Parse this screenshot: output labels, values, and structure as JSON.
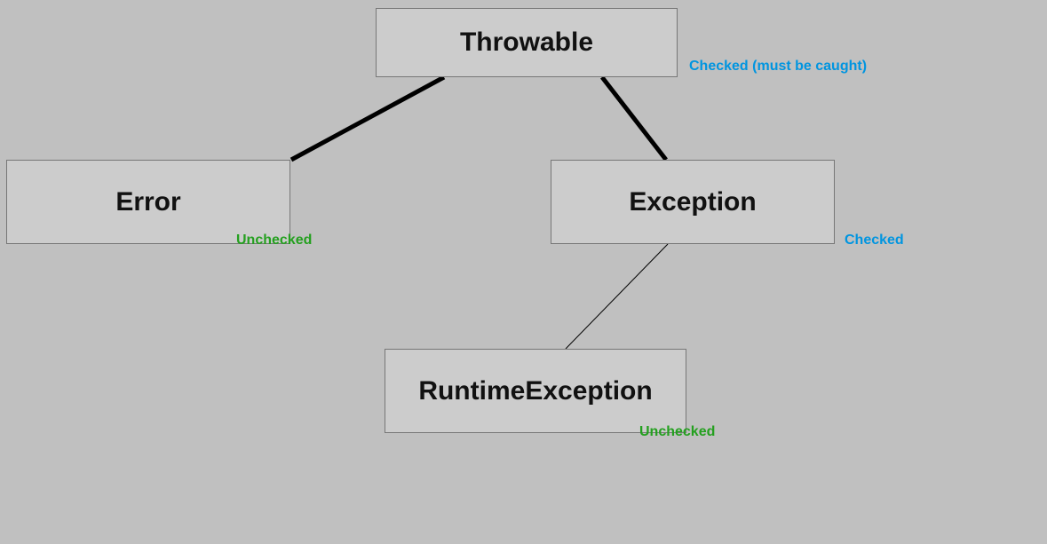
{
  "nodes": {
    "throwable": {
      "label": "Throwable",
      "annotation": "Checked (must be caught)",
      "annotationType": "checked"
    },
    "error": {
      "label": "Error",
      "annotation": "Unchecked",
      "annotationType": "unchecked"
    },
    "exception": {
      "label": "Exception",
      "annotation": "Checked",
      "annotationType": "checked"
    },
    "runtimeException": {
      "label": "RuntimeException",
      "annotation": "Unchecked",
      "annotationType": "unchecked"
    }
  },
  "edges": [
    {
      "from": "throwable",
      "to": "error",
      "thick": true
    },
    {
      "from": "throwable",
      "to": "exception",
      "thick": true
    },
    {
      "from": "exception",
      "to": "runtimeException",
      "thick": false
    }
  ]
}
